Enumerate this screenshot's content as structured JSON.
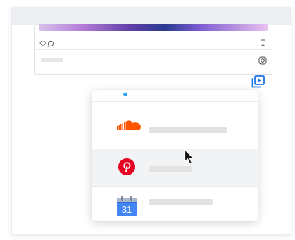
{
  "colors": {
    "soundcloud": "#ff5500",
    "pinterest": "#e60023",
    "gcal_blue": "#4285f4",
    "twitter": "#1da1f2",
    "share_blue": "#1a73e8"
  },
  "post": {
    "icons": [
      "heart-icon",
      "comment-icon",
      "bookmark-icon",
      "instagram-icon"
    ]
  },
  "menu": {
    "items": [
      {
        "name": "twitter",
        "icon": "twitter-icon"
      },
      {
        "name": "soundcloud",
        "icon": "soundcloud-icon"
      },
      {
        "name": "pinterest",
        "icon": "pinterest-icon",
        "selected": true
      },
      {
        "name": "google-calendar",
        "icon": "google-calendar-icon",
        "date": "31"
      }
    ]
  },
  "share_button": {
    "icon": "share-play-icon"
  }
}
